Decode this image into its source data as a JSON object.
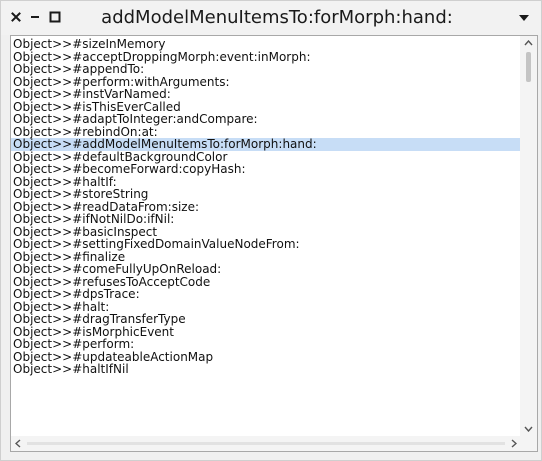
{
  "window": {
    "title": "addModelMenuItemsTo:forMorph:hand:",
    "close_icon": "close-icon",
    "minimize_icon": "minimize-icon",
    "maximize_icon": "maximize-icon",
    "menu_icon": "chevron-down-icon"
  },
  "colors": {
    "selection": "#c7ddf6",
    "text": "#111111",
    "window_bg": "#f0f0f0",
    "list_bg": "#ffffff"
  },
  "list": {
    "selected_index": 10,
    "items": [
      "Object>>#sizeInMemory",
      "Object>>#acceptDroppingMorph:event:inMorph:",
      "Object>>#appendTo:",
      "Object>>#perform:withArguments:",
      "Object>>#instVarNamed:",
      "Object>>#isThisEverCalled",
      "Object>>#adaptToInteger:andCompare:",
      "Object>>#rebindOn:at:",
      "Object>>#addModelMenuItemsTo:forMorph:hand:",
      "Object>>#defaultBackgroundColor",
      "Object>>#becomeForward:copyHash:",
      "Object>>#haltIf:",
      "Object>>#storeString",
      "Object>>#readDataFrom:size:",
      "Object>>#ifNotNilDo:ifNil:",
      "Object>>#basicInspect",
      "Object>>#settingFixedDomainValueNodeFrom:",
      "Object>>#finalize",
      "Object>>#comeFullyUpOnReload:",
      "Object>>#refusesToAcceptCode",
      "Object>>#dpsTrace:",
      "Object>>#halt:",
      "Object>>#dragTransferType",
      "Object>>#isMorphicEvent",
      "Object>>#perform:",
      "Object>>#updateableActionMap",
      "Object>>#haltIfNil"
    ]
  },
  "scrollbars": {
    "vertical_position": 0.0,
    "up_arrow_icon": "chevron-up-icon",
    "down_arrow_icon": "chevron-down-icon",
    "left_arrow_icon": "chevron-left-icon",
    "right_arrow_icon": "chevron-right-icon"
  }
}
